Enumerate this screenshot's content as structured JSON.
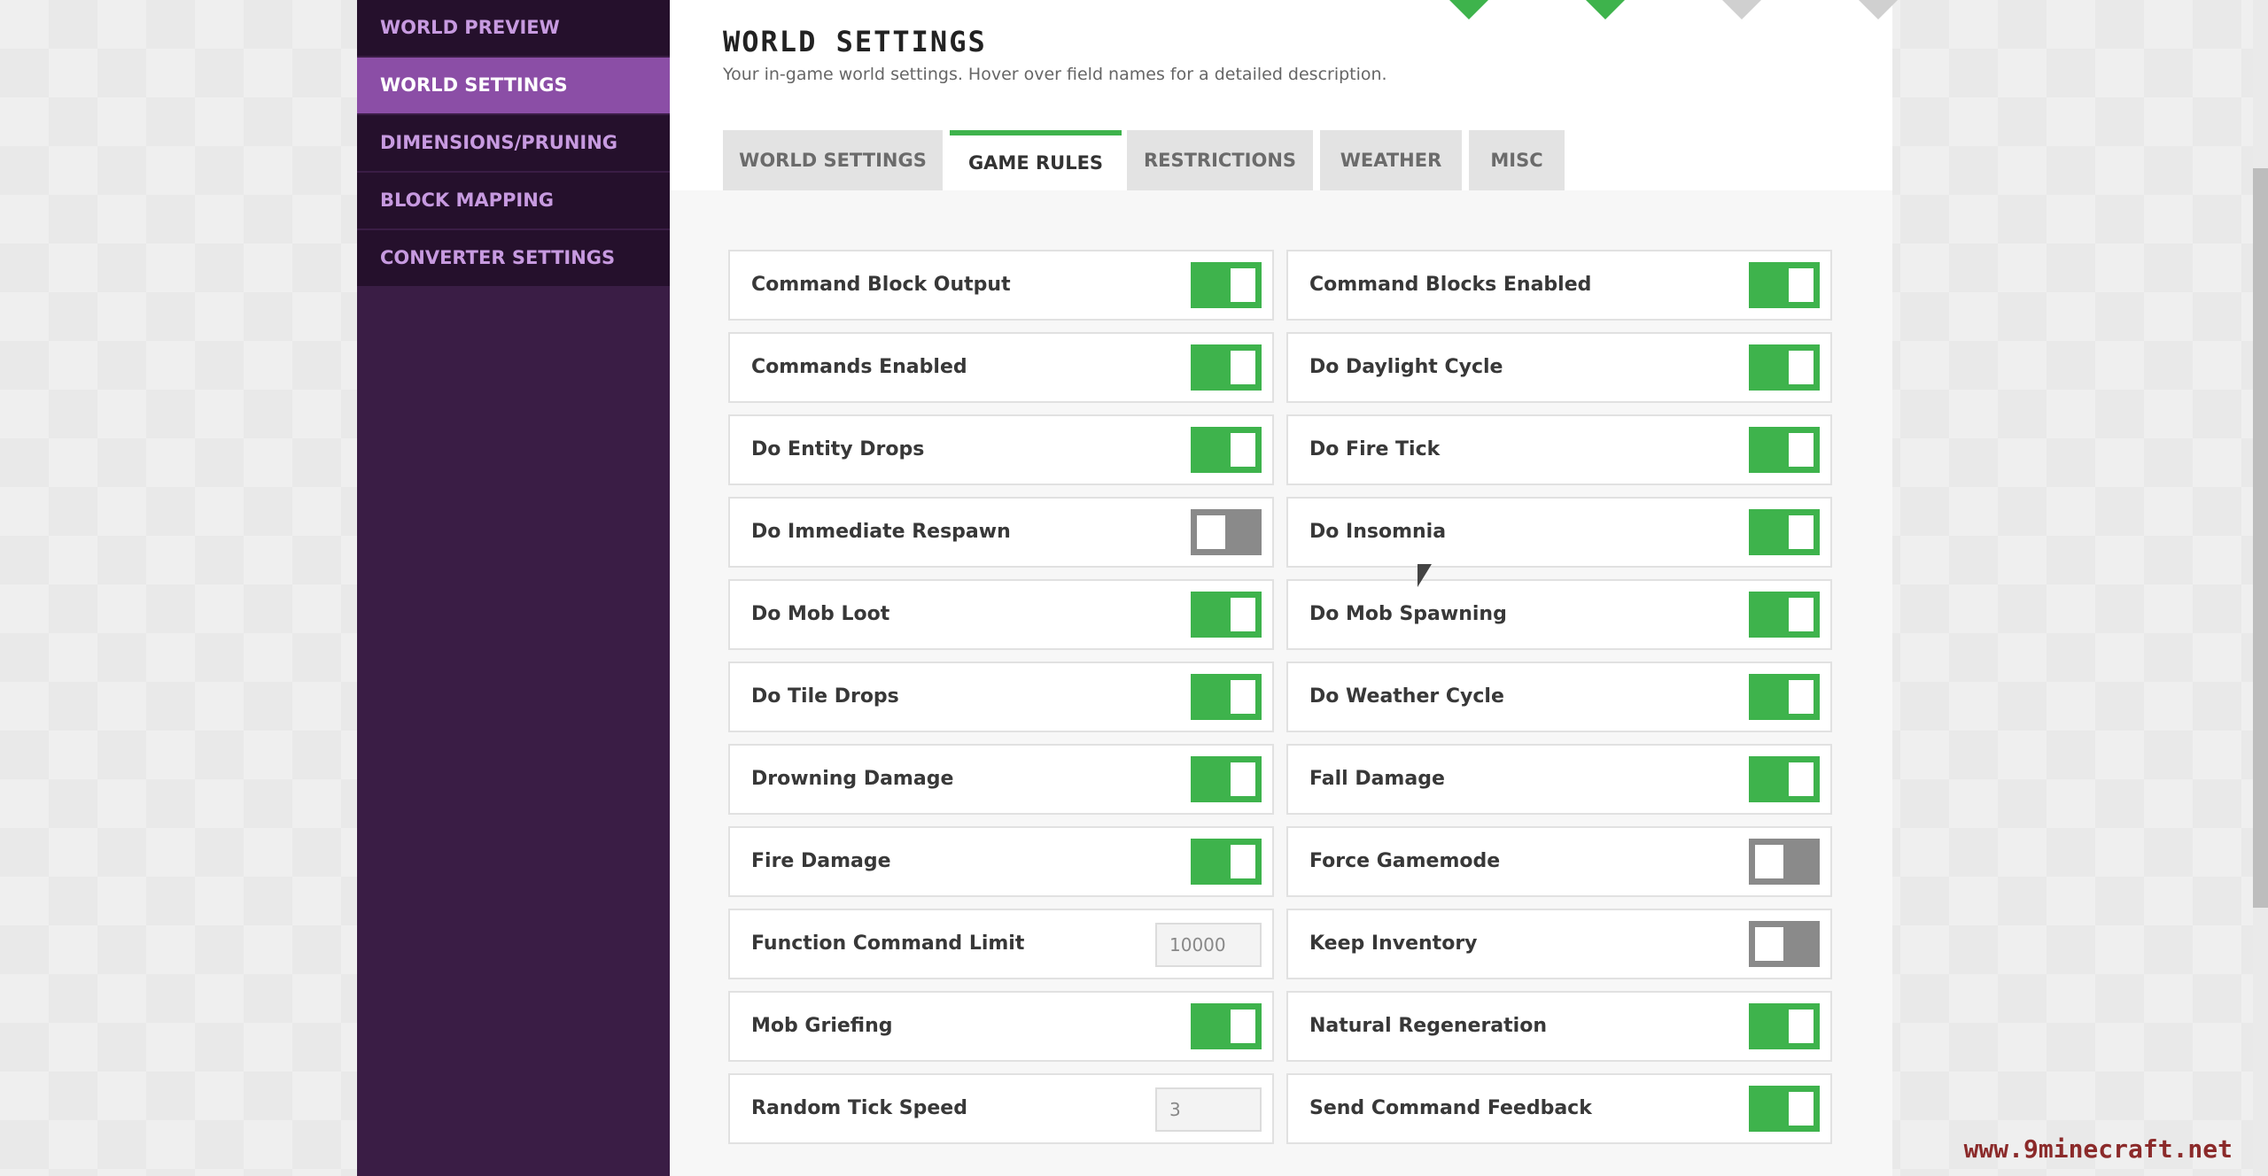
{
  "sidebar": {
    "items": [
      {
        "label": "WORLD PREVIEW"
      },
      {
        "label": "WORLD SETTINGS"
      },
      {
        "label": "DIMENSIONS/PRUNING"
      },
      {
        "label": "BLOCK MAPPING"
      },
      {
        "label": "CONVERTER SETTINGS"
      }
    ],
    "active": "WORLD SETTINGS"
  },
  "header": {
    "title": "WORLD SETTINGS",
    "subtitle": "Your in-game world settings. Hover over field names for a detailed description."
  },
  "tabs": [
    {
      "label": "WORLD SETTINGS"
    },
    {
      "label": "GAME RULES"
    },
    {
      "label": "RESTRICTIONS"
    },
    {
      "label": "WEATHER"
    },
    {
      "label": "MISC"
    }
  ],
  "active_tab": "GAME RULES",
  "rules": {
    "left": [
      {
        "label": "Command Block Output",
        "type": "toggle",
        "state": "on"
      },
      {
        "label": "Commands Enabled",
        "type": "toggle",
        "state": "on"
      },
      {
        "label": "Do Entity Drops",
        "type": "toggle",
        "state": "on"
      },
      {
        "label": "Do Immediate Respawn",
        "type": "toggle",
        "state": "off"
      },
      {
        "label": "Do Mob Loot",
        "type": "toggle",
        "state": "on"
      },
      {
        "label": "Do Tile Drops",
        "type": "toggle",
        "state": "on"
      },
      {
        "label": "Drowning Damage",
        "type": "toggle",
        "state": "on"
      },
      {
        "label": "Fire Damage",
        "type": "toggle",
        "state": "on"
      },
      {
        "label": "Function Command Limit",
        "type": "number",
        "value": "10000"
      },
      {
        "label": "Mob Griefing",
        "type": "toggle",
        "state": "on"
      },
      {
        "label": "Random Tick Speed",
        "type": "number",
        "value": "3"
      }
    ],
    "right": [
      {
        "label": "Command Blocks Enabled",
        "type": "toggle",
        "state": "on"
      },
      {
        "label": "Do Daylight Cycle",
        "type": "toggle",
        "state": "on"
      },
      {
        "label": "Do Fire Tick",
        "type": "toggle",
        "state": "on"
      },
      {
        "label": "Do Insomnia",
        "type": "toggle",
        "state": "on"
      },
      {
        "label": "Do Mob Spawning",
        "type": "toggle",
        "state": "on"
      },
      {
        "label": "Do Weather Cycle",
        "type": "toggle",
        "state": "on"
      },
      {
        "label": "Fall Damage",
        "type": "toggle",
        "state": "on"
      },
      {
        "label": "Force Gamemode",
        "type": "toggle",
        "state": "off"
      },
      {
        "label": "Keep Inventory",
        "type": "toggle",
        "state": "off"
      },
      {
        "label": "Natural Regeneration",
        "type": "toggle",
        "state": "on"
      },
      {
        "label": "Send Command Feedback",
        "type": "toggle",
        "state": "on"
      }
    ]
  },
  "watermark": "www.9minecraft.net",
  "colors": {
    "accent": "#3eb34c",
    "sidebar": "#3a1d45",
    "sidebar_active": "#8b4ea6",
    "toggle_off": "#8a8a8a"
  }
}
